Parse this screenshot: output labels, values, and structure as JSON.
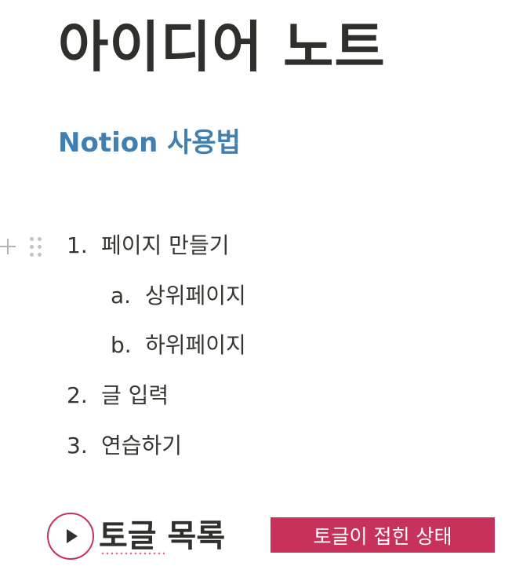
{
  "page": {
    "title": "아이디어 노트",
    "section_heading": "Notion 사용법"
  },
  "icons": {
    "add_block": "plus-icon",
    "drag_handle": "drag-handle-icon",
    "toggle": "triangle-right-icon"
  },
  "list": {
    "items": [
      {
        "marker": "1.",
        "label": "페이지 만들기",
        "children": [
          {
            "marker": "a.",
            "label": "상위페이지"
          },
          {
            "marker": "b.",
            "label": "하위페이지"
          }
        ]
      },
      {
        "marker": "2.",
        "label": "글 입력"
      },
      {
        "marker": "3.",
        "label": "연습하기"
      }
    ]
  },
  "toggle": {
    "title": "토글 목록",
    "collapsed": true
  },
  "annotation": {
    "label": "토글이 접힌 상태"
  },
  "colors": {
    "text": "#37352f",
    "heading_blue": "#3f7fb1",
    "annotation_red": "#c8325a",
    "handle_gray": "#b6b5b0"
  }
}
